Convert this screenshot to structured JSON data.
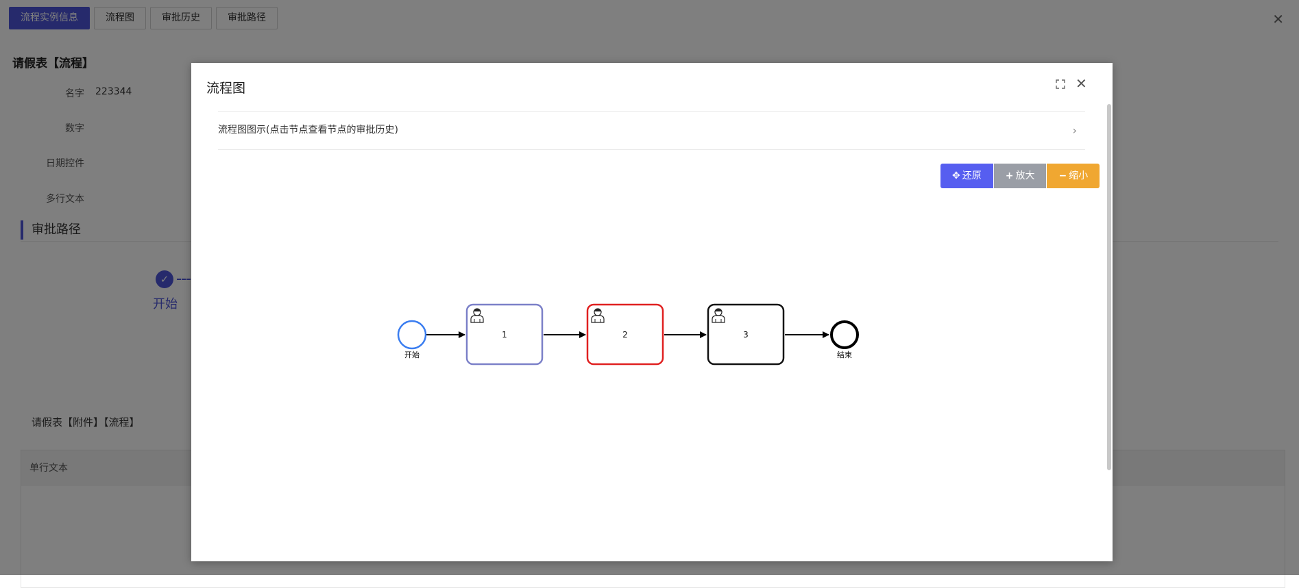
{
  "tabs": [
    "流程实例信息",
    "流程图",
    "审批历史",
    "审批路径"
  ],
  "form": {
    "title": "请假表【流程】",
    "fields": [
      {
        "label": "名字",
        "value": "223344"
      },
      {
        "label": "数字",
        "value": ""
      },
      {
        "label": "日期控件",
        "value": ""
      },
      {
        "label": "多行文本",
        "value": ""
      }
    ]
  },
  "approval_path": {
    "title": "审批路径",
    "steps": [
      {
        "label": "开始"
      }
    ]
  },
  "sub_form": {
    "title": "请假表【附件】【流程】",
    "columns": [
      "单行文本"
    ]
  },
  "modal": {
    "title": "流程图",
    "collapse_title": "流程图图示(点击节点查看节点的审批历史)",
    "buttons": {
      "reset": "还原",
      "zoom_in": "放大",
      "zoom_out": "缩小"
    },
    "diagram": {
      "start_label": "开始",
      "end_label": "结束",
      "tasks": [
        {
          "label": "1",
          "status": "completed",
          "color": "#7b80c8"
        },
        {
          "label": "2",
          "status": "active",
          "color": "#e02020"
        },
        {
          "label": "3",
          "status": "pending",
          "color": "#111111"
        }
      ],
      "start_color": "#3a7df0",
      "end_color": "#000000"
    }
  }
}
